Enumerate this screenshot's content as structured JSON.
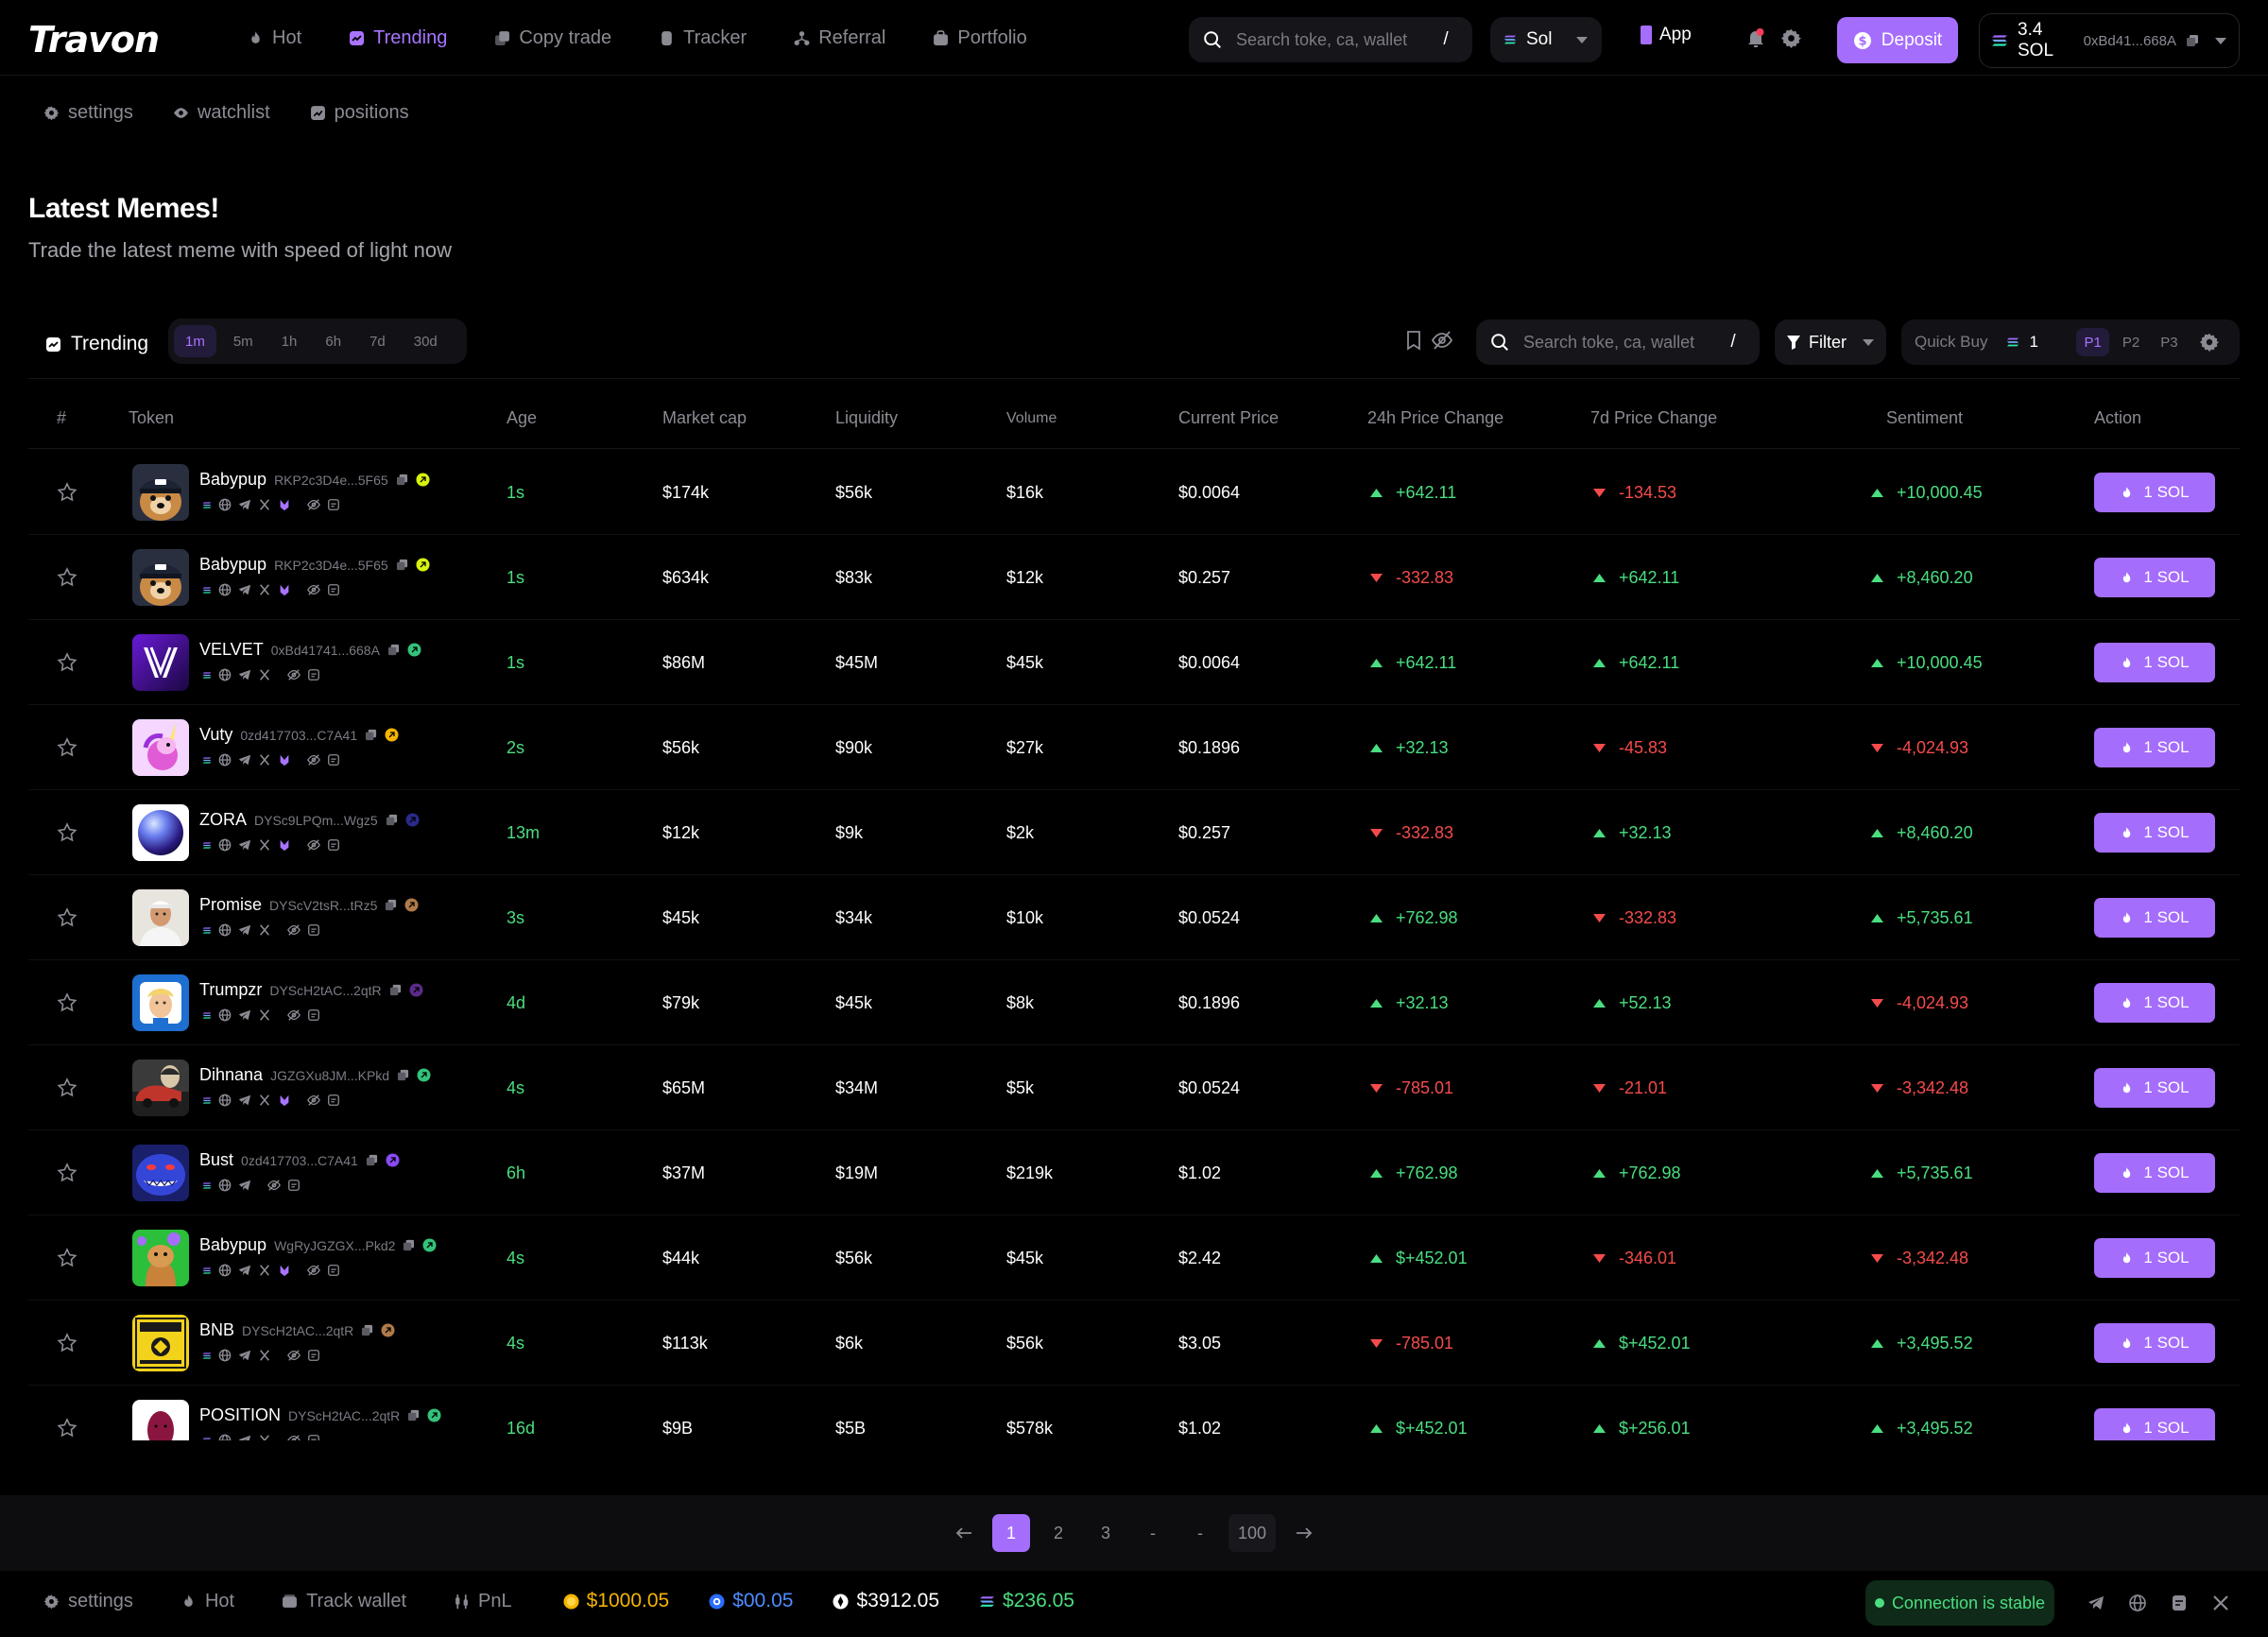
{
  "app": {
    "logo": "Travon"
  },
  "nav": [
    {
      "label": "Hot",
      "icon": "flame-icon",
      "active": false
    },
    {
      "label": "Trending",
      "icon": "trending-icon",
      "active": true
    },
    {
      "label": "Copy trade",
      "icon": "copy-icon",
      "active": false
    },
    {
      "label": "Tracker",
      "icon": "tracker-icon",
      "active": false
    },
    {
      "label": "Referral",
      "icon": "referral-icon",
      "active": false
    },
    {
      "label": "Portfolio",
      "icon": "portfolio-icon",
      "active": false
    }
  ],
  "top_search": {
    "placeholder": "Search toke, ca, wallet",
    "shortcut": "/"
  },
  "chain": {
    "selected": "Sol"
  },
  "app_button": "App",
  "deposit_label": "Deposit",
  "wallet": {
    "balance": "3.4 SOL",
    "address": "0xBd41...668A"
  },
  "subnav": [
    {
      "label": "settings",
      "icon": "gear-icon"
    },
    {
      "label": "watchlist",
      "icon": "eye-icon"
    },
    {
      "label": "positions",
      "icon": "positions-icon"
    }
  ],
  "hero": {
    "title": "Latest Memes!",
    "subtitle": "Trade the latest meme with speed of light now"
  },
  "toolbar": {
    "trending_label": "Trending",
    "timeframes": [
      {
        "label": "1m",
        "active": true
      },
      {
        "label": "5m",
        "active": false
      },
      {
        "label": "1h",
        "active": false
      },
      {
        "label": "6h",
        "active": false
      },
      {
        "label": "7d",
        "active": false
      },
      {
        "label": "30d",
        "active": false
      }
    ],
    "search_placeholder": "Search toke, ca, wallet",
    "search_shortcut": "/",
    "filter_label": "Filter",
    "quick_buy_label": "Quick Buy",
    "quick_buy_amount": "1",
    "presets": [
      {
        "label": "P1",
        "active": true
      },
      {
        "label": "P2",
        "active": false
      },
      {
        "label": "P3",
        "active": false
      }
    ]
  },
  "table": {
    "headers": {
      "index": "#",
      "token": "Token",
      "age": "Age",
      "market_cap": "Market cap",
      "liquidity": "Liquidity",
      "volume": "Volume",
      "price": "Current Price",
      "change_24h": "24h Price Change",
      "change_7d": "7d Price Change",
      "sentiment": "Sentiment",
      "action": "Action"
    },
    "buy_label": "1 SOL",
    "rows": [
      {
        "name": "Babypup",
        "ca": "RKP2c3D4e...5F65",
        "avatar": "dog",
        "badge": "#d7f20d",
        "age": "1s",
        "mcap": "$174k",
        "liq": "$56k",
        "vol": "$16k",
        "price": "$0.0064",
        "c24": "+642.11",
        "c24_dir": "up",
        "c7": "-134.53",
        "c7_dir": "down",
        "sent": "+10,000.45",
        "sent_dir": "up",
        "socials": [
          "sol",
          "globe",
          "telegram",
          "x",
          "pump",
          "eye-off",
          "doc"
        ]
      },
      {
        "name": "Babypup",
        "ca": "RKP2c3D4e...5F65",
        "avatar": "dog",
        "badge": "#d7f20d",
        "age": "1s",
        "mcap": "$634k",
        "liq": "$83k",
        "vol": "$12k",
        "price": "$0.257",
        "c24": "-332.83",
        "c24_dir": "down",
        "c7": "+642.11",
        "c7_dir": "up",
        "sent": "+8,460.20",
        "sent_dir": "up",
        "socials": [
          "sol",
          "globe",
          "telegram",
          "x",
          "pump",
          "eye-off",
          "doc"
        ]
      },
      {
        "name": "VELVET",
        "ca": "0xBd41741...668A",
        "avatar": "velvet",
        "badge": "#33c27a",
        "age": "1s",
        "mcap": "$86M",
        "liq": "$45M",
        "vol": "$45k",
        "price": "$0.0064",
        "c24": "+642.11",
        "c24_dir": "up",
        "c7": "+642.11",
        "c7_dir": "up",
        "sent": "+10,000.45",
        "sent_dir": "up",
        "socials": [
          "sol",
          "globe",
          "telegram",
          "x",
          "eye-off",
          "doc"
        ]
      },
      {
        "name": "Vuty",
        "ca": "0zd417703...C7A41",
        "avatar": "unicorn",
        "badge": "#f5b400",
        "age": "2s",
        "mcap": "$56k",
        "liq": "$90k",
        "vol": "$27k",
        "price": "$0.1896",
        "c24": "+32.13",
        "c24_dir": "up",
        "c7": "-45.83",
        "c7_dir": "down",
        "sent": "-4,024.93",
        "sent_dir": "down",
        "socials": [
          "sol",
          "globe",
          "telegram",
          "x",
          "pump",
          "eye-off",
          "doc"
        ]
      },
      {
        "name": "ZORA",
        "ca": "DYSc9LPQm...Wgz5",
        "avatar": "zora",
        "badge": "#2a2a8a",
        "age": "13m",
        "mcap": "$12k",
        "liq": "$9k",
        "vol": "$2k",
        "price": "$0.257",
        "c24": "-332.83",
        "c24_dir": "down",
        "c7": "+32.13",
        "c7_dir": "up",
        "sent": "+8,460.20",
        "sent_dir": "up",
        "socials": [
          "sol",
          "globe",
          "telegram",
          "x",
          "pump",
          "eye-off",
          "doc"
        ]
      },
      {
        "name": "Promise",
        "ca": "DYScV2tsR...tRz5",
        "avatar": "man",
        "badge": "#b07a4a",
        "age": "3s",
        "mcap": "$45k",
        "liq": "$34k",
        "vol": "$10k",
        "price": "$0.0524",
        "c24": "+762.98",
        "c24_dir": "up",
        "c7": "-332.83",
        "c7_dir": "down",
        "sent": "+5,735.61",
        "sent_dir": "up",
        "socials": [
          "sol",
          "globe",
          "telegram",
          "x",
          "eye-off",
          "doc"
        ]
      },
      {
        "name": "Trumpzr",
        "ca": "DYScH2tAC...2qtR",
        "avatar": "trump",
        "badge": "#5b2a8a",
        "age": "4d",
        "mcap": "$79k",
        "liq": "$45k",
        "vol": "$8k",
        "price": "$0.1896",
        "c24": "+32.13",
        "c24_dir": "up",
        "c7": "+52.13",
        "c7_dir": "up",
        "sent": "-4,024.93",
        "sent_dir": "down",
        "socials": [
          "sol",
          "globe",
          "telegram",
          "x",
          "eye-off",
          "doc"
        ]
      },
      {
        "name": "Dihnana",
        "ca": "JGZGXu8JM...KPkd",
        "avatar": "car",
        "badge": "#33c27a",
        "age": "4s",
        "mcap": "$65M",
        "liq": "$34M",
        "vol": "$5k",
        "price": "$0.0524",
        "c24": "-785.01",
        "c24_dir": "down",
        "c7": "-21.01",
        "c7_dir": "down",
        "sent": "-3,342.48",
        "sent_dir": "down",
        "socials": [
          "sol",
          "globe",
          "telegram",
          "x",
          "pump",
          "eye-off",
          "doc"
        ]
      },
      {
        "name": "Bust",
        "ca": "0zd417703...C7A41",
        "avatar": "monster",
        "badge": "#8a4af5",
        "age": "6h",
        "mcap": "$37M",
        "liq": "$19M",
        "vol": "$219k",
        "price": "$1.02",
        "c24": "+762.98",
        "c24_dir": "up",
        "c7": "+762.98",
        "c7_dir": "up",
        "sent": "+5,735.61",
        "sent_dir": "up",
        "socials": [
          "sol",
          "globe",
          "telegram",
          "eye-off",
          "doc"
        ]
      },
      {
        "name": "Babypup",
        "ca": "WgRyJGZGX...Pkd2",
        "avatar": "frog",
        "badge": "#33c27a",
        "age": "4s",
        "mcap": "$44k",
        "liq": "$56k",
        "vol": "$45k",
        "price": "$2.42",
        "c24": "$+452.01",
        "c24_dir": "up",
        "c7": "-346.01",
        "c7_dir": "down",
        "sent": "-3,342.48",
        "sent_dir": "down",
        "socials": [
          "sol",
          "globe",
          "telegram",
          "x",
          "pump",
          "eye-off",
          "doc"
        ]
      },
      {
        "name": "BNB",
        "ca": "DYScH2tAC...2qtR",
        "avatar": "bnb",
        "badge": "#b07a4a",
        "age": "4s",
        "mcap": "$113k",
        "liq": "$6k",
        "vol": "$56k",
        "price": "$3.05",
        "c24": "-785.01",
        "c24_dir": "down",
        "c7": "$+452.01",
        "c7_dir": "up",
        "sent": "+3,495.52",
        "sent_dir": "up",
        "socials": [
          "sol",
          "globe",
          "telegram",
          "x",
          "eye-off",
          "doc"
        ]
      },
      {
        "name": "POSITION",
        "ca": "DYScH2tAC...2qtR",
        "avatar": "position",
        "badge": "#33c27a",
        "age": "16d",
        "mcap": "$9B",
        "liq": "$5B",
        "vol": "$578k",
        "price": "$1.02",
        "c24": "$+452.01",
        "c24_dir": "up",
        "c7": "$+256.01",
        "c7_dir": "up",
        "sent": "+3,495.52",
        "sent_dir": "up",
        "socials": [
          "sol",
          "globe",
          "telegram",
          "x",
          "eye-off",
          "doc"
        ]
      }
    ]
  },
  "pagination": {
    "pages": [
      "1",
      "2",
      "3",
      "-",
      "-",
      "100"
    ],
    "current": "1"
  },
  "footer": {
    "links": [
      {
        "label": "settings",
        "icon": "gear-icon"
      },
      {
        "label": "Hot",
        "icon": "flame-icon"
      },
      {
        "label": "Track wallet",
        "icon": "wallet-icon"
      },
      {
        "label": "PnL",
        "icon": "pnl-icon"
      }
    ],
    "prices": [
      {
        "value": "$1000.05",
        "color": "#f5b400",
        "icon": "coin-gold-icon"
      },
      {
        "value": "$00.05",
        "color": "#4d8dff",
        "icon": "coin-blue-icon"
      },
      {
        "value": "$3912.05",
        "color": "#ffffff",
        "icon": "coin-white-icon"
      },
      {
        "value": "$236.05",
        "color": "#4ade80",
        "icon": "sol-icon"
      }
    ],
    "connection": "Connection is stable"
  },
  "colors": {
    "accent": "#a56dfc",
    "accent_text": "#a874ff",
    "up": "#4ade80",
    "down": "#f54b4b"
  }
}
